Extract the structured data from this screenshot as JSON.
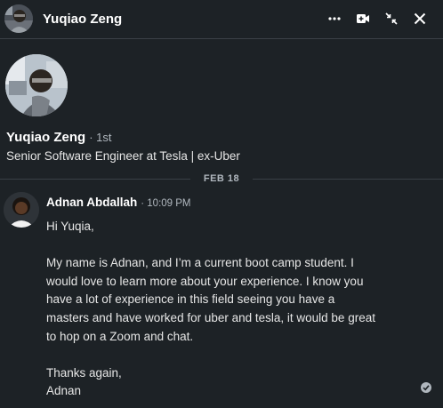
{
  "header": {
    "name": "Yuqiao Zeng",
    "icons": [
      "more-icon",
      "video-icon",
      "minimize-icon",
      "close-icon"
    ]
  },
  "profile": {
    "name": "Yuqiao Zeng",
    "degree": "· 1st",
    "headline": "Senior Software Engineer at Tesla | ex-Uber"
  },
  "date_divider": "FEB 18",
  "message": {
    "sender": "Adnan Abdallah",
    "time": "· 10:09 PM",
    "lines": {
      "l1": "Hi Yuqia,",
      "l2": "My name is Adnan, and I’m a current boot camp student. I",
      "l3": "would love to learn more about your experience. I know you",
      "l4": "have a lot of experience in this field seeing you have a",
      "l5": "masters and have worked for uber and tesla, it would be great",
      "l6": "to hop on a Zoom and chat.",
      "l7": "Thanks again,",
      "l8": "Adnan"
    }
  },
  "colors": {
    "background": "#1d2226",
    "text": "#e6e6e6",
    "muted": "#b0b7be",
    "divider": "#3a4046"
  }
}
